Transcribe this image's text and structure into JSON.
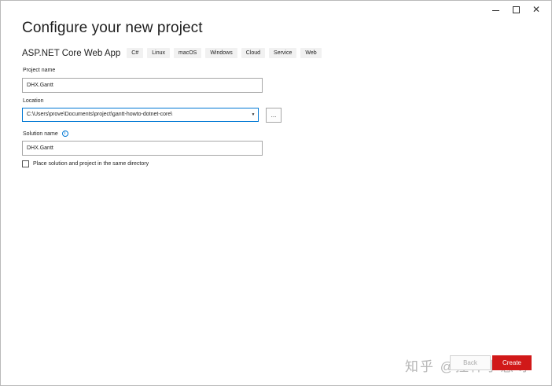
{
  "window_controls": {
    "minimize_icon": "minimize-icon",
    "maximize_icon": "maximize-icon",
    "close_glyph": "✕"
  },
  "header": {
    "title": "Configure your new project"
  },
  "template": {
    "name": "ASP.NET Core Web App",
    "tags": [
      "C#",
      "Linux",
      "macOS",
      "Windows",
      "Cloud",
      "Service",
      "Web"
    ]
  },
  "form": {
    "project_name_label": "Project name",
    "project_name_value": "DHX.Gantt",
    "location_label": "Location",
    "location_value": "C:\\Users\\prove\\Documents\\project\\gantt-howto-dotnet-core\\",
    "browse_label": "...",
    "solution_name_label": "Solution name",
    "solution_name_value": "DHX.Gantt",
    "info_glyph": "i",
    "same_directory_label": "Place solution and project in the same directory",
    "same_directory_checked": false
  },
  "footer": {
    "watermark": "知乎 @控件小慧呀",
    "back_label": "Back",
    "create_label": "Create"
  },
  "colors": {
    "accent": "#0078d4",
    "create_button": "#d11919"
  }
}
